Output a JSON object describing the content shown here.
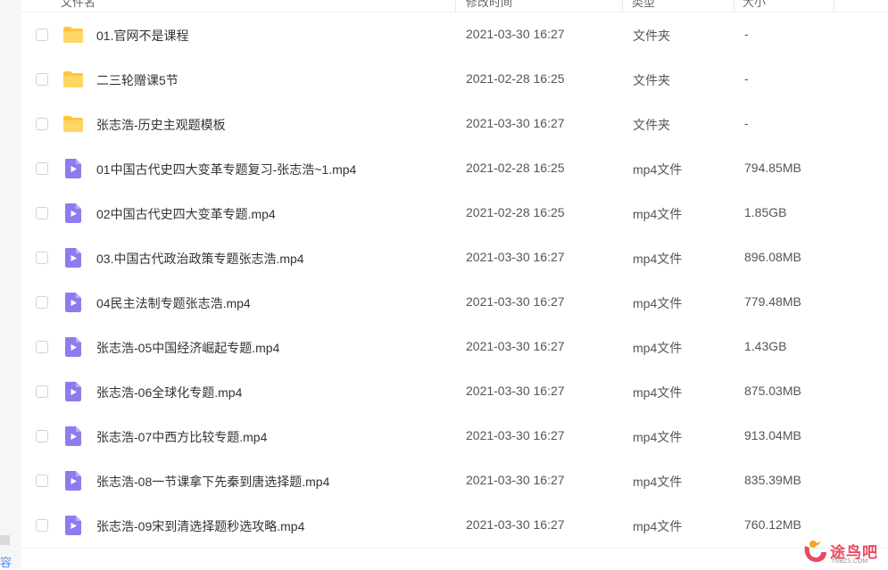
{
  "left_panel": {
    "partial_text": "容"
  },
  "columns": {
    "name": "文件名",
    "modified": "修改时间",
    "type": "类型",
    "size": "大小"
  },
  "files": [
    {
      "icon": "folder-icon",
      "name": "01.官网不是课程",
      "modified": "2021-03-30 16:27",
      "type": "文件夹",
      "size": "-"
    },
    {
      "icon": "folder-icon",
      "name": "二三轮赠课5节",
      "modified": "2021-02-28 16:25",
      "type": "文件夹",
      "size": "-"
    },
    {
      "icon": "folder-icon",
      "name": "张志浩-历史主观题模板",
      "modified": "2021-03-30 16:27",
      "type": "文件夹",
      "size": "-"
    },
    {
      "icon": "video-file-icon",
      "name": "01中国古代史四大变革专题复习-张志浩~1.mp4",
      "modified": "2021-02-28 16:25",
      "type": "mp4文件",
      "size": "794.85MB"
    },
    {
      "icon": "video-file-icon",
      "name": "02中国古代史四大变革专题.mp4",
      "modified": "2021-02-28 16:25",
      "type": "mp4文件",
      "size": "1.85GB"
    },
    {
      "icon": "video-file-icon",
      "name": "03.中国古代政治政策专题张志浩.mp4",
      "modified": "2021-03-30 16:27",
      "type": "mp4文件",
      "size": "896.08MB"
    },
    {
      "icon": "video-file-icon",
      "name": "04民主法制专题张志浩.mp4",
      "modified": "2021-03-30 16:27",
      "type": "mp4文件",
      "size": "779.48MB"
    },
    {
      "icon": "video-file-icon",
      "name": "张志浩-05中国经济崛起专题.mp4",
      "modified": "2021-03-30 16:27",
      "type": "mp4文件",
      "size": "1.43GB"
    },
    {
      "icon": "video-file-icon",
      "name": "张志浩-06全球化专题.mp4",
      "modified": "2021-03-30 16:27",
      "type": "mp4文件",
      "size": "875.03MB"
    },
    {
      "icon": "video-file-icon",
      "name": "张志浩-07中西方比较专题.mp4",
      "modified": "2021-03-30 16:27",
      "type": "mp4文件",
      "size": "913.04MB"
    },
    {
      "icon": "video-file-icon",
      "name": "张志浩-08一节课拿下先秦到唐选择题.mp4",
      "modified": "2021-03-30 16:27",
      "type": "mp4文件",
      "size": "835.39MB"
    },
    {
      "icon": "video-file-icon",
      "name": "张志浩-09宋到清选择题秒选攻略.mp4",
      "modified": "2021-03-30 16:27",
      "type": "mp4文件",
      "size": "760.12MB"
    }
  ],
  "watermark": {
    "text": "途鸟吧",
    "sub": "TNBZS.COM"
  },
  "colors": {
    "folder": "#ffc53d",
    "video": "#8c7cf0",
    "border": "#eef0f4"
  }
}
